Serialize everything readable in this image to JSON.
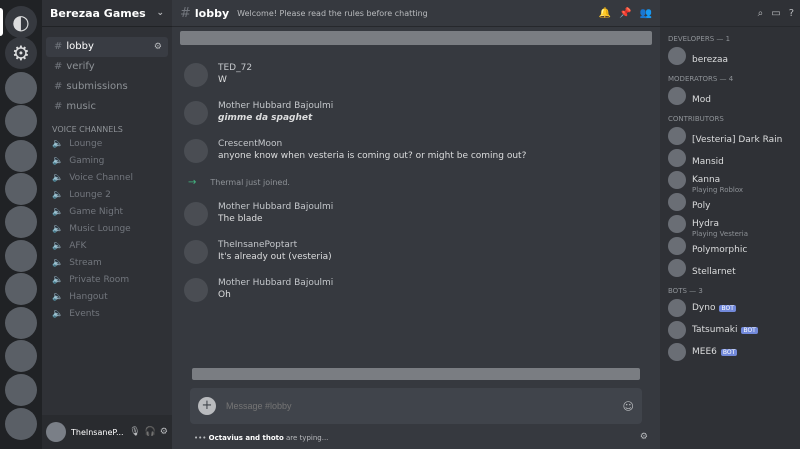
{
  "server": {
    "name": "Berezaa Games",
    "categories": [
      {
        "name": "",
        "channels": [
          {
            "name": "lobby",
            "active": true
          },
          {
            "name": "verify"
          },
          {
            "name": "submissions"
          },
          {
            "name": "music"
          }
        ]
      }
    ],
    "voice_section_label": "Voice Channels",
    "voice_channels": [
      "Lounge",
      "Gaming",
      "Voice Channel",
      "Lounge 2",
      "Game Night",
      "Music Lounge",
      "AFK",
      "Stream",
      "Private Room",
      "Hangout",
      "Events"
    ]
  },
  "user": {
    "name": "TheInsaneP..."
  },
  "channel": {
    "name": "lobby",
    "topic": "Welcome! Please read the rules before chatting"
  },
  "messages": [
    {
      "author": "TED_72",
      "time": "",
      "text": "W",
      "italic": false
    },
    {
      "author": "Mother Hubbard Bajoulmi",
      "time": "",
      "text": "gimme da spaghet",
      "italic": true
    },
    {
      "author": "CrescentMoon",
      "time": "",
      "text": "anyone know when vesteria is coming out? or might be coming out?",
      "italic": false
    },
    {
      "author": "",
      "time": "",
      "text": "Thermal just joined.",
      "join": true
    },
    {
      "author": "Mother Hubbard Bajoulmi",
      "time": "",
      "text": "The blade",
      "italic": false
    },
    {
      "author": "TheInsanePoptart",
      "time": "",
      "text": "It's already out (vesteria)",
      "italic": false
    },
    {
      "author": "Mother Hubbard Bajoulmi",
      "time": "",
      "text": "Oh",
      "italic": false
    }
  ],
  "composer": {
    "placeholder": "Message #lobby"
  },
  "typing": {
    "users": "Octavius and thoto",
    "suffix": " are typing..."
  },
  "members": {
    "groups": [
      {
        "label": "Developers — 1",
        "items": [
          {
            "name": "berezaa",
            "sub": "",
            "tag": ""
          }
        ]
      },
      {
        "label": "Moderators — 4",
        "items": [
          {
            "name": "Mod",
            "sub": "",
            "tag": ""
          }
        ]
      },
      {
        "label": "Contributors",
        "items": [
          {
            "name": "[Vesteria] Dark Rain",
            "sub": "",
            "tag": ""
          },
          {
            "name": "Mansid",
            "sub": "",
            "tag": ""
          },
          {
            "name": "Kanna",
            "sub": "Playing Roblox",
            "tag": ""
          },
          {
            "name": "Poly",
            "sub": "",
            "tag": ""
          },
          {
            "name": "Hydra",
            "sub": "Playing Vesteria",
            "tag": ""
          },
          {
            "name": "Polymorphic",
            "sub": "",
            "tag": ""
          },
          {
            "name": "Stellarnet",
            "sub": "",
            "tag": ""
          }
        ]
      },
      {
        "label": "Bots — 3",
        "items": [
          {
            "name": "Dyno",
            "sub": "",
            "tag": "BOT"
          },
          {
            "name": "Tatsumaki",
            "sub": "",
            "tag": "BOT"
          },
          {
            "name": "MEE6",
            "sub": "",
            "tag": "BOT"
          }
        ]
      }
    ]
  }
}
